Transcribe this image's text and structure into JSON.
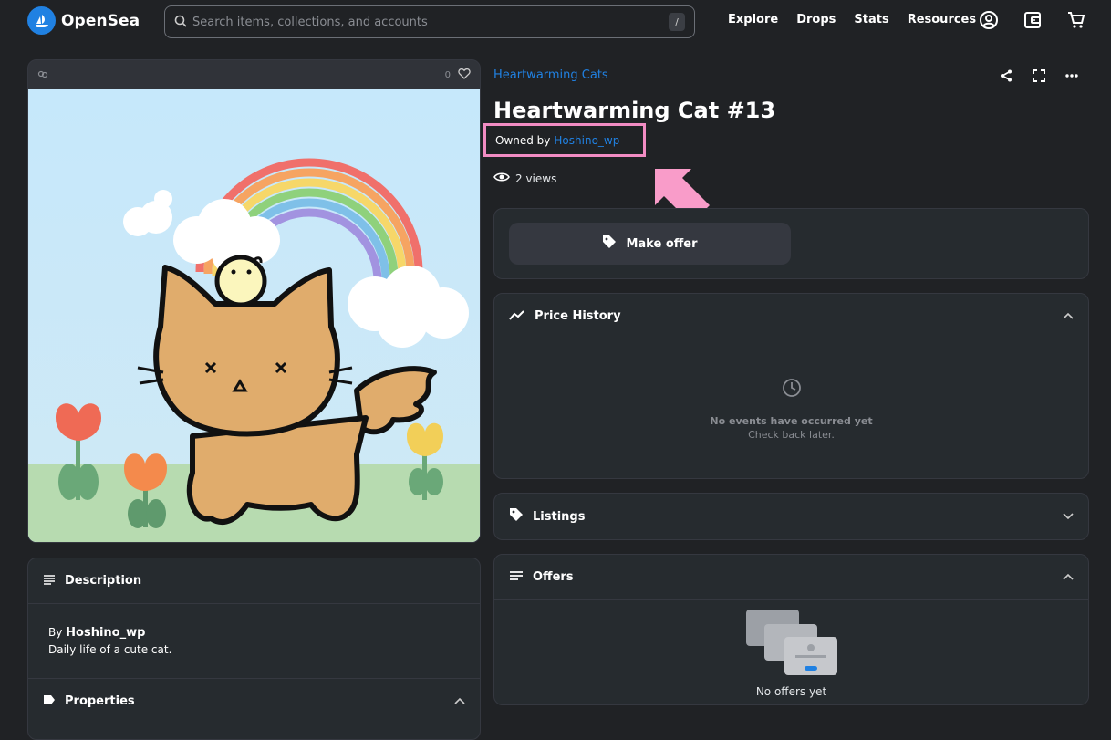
{
  "brand": {
    "name": "OpenSea",
    "color": "#2081e2"
  },
  "search": {
    "placeholder": "Search items, collections, and accounts",
    "shortcut": "/"
  },
  "nav": {
    "explore": "Explore",
    "drops": "Drops",
    "stats": "Stats",
    "resources": "Resources"
  },
  "media": {
    "favorites": "0"
  },
  "asset": {
    "collection": "Heartwarming Cats",
    "title": "Heartwarming Cat #13",
    "owned_by_label": "Owned by",
    "owner": "Hoshino_wp",
    "views": "2 views"
  },
  "offer": {
    "make_offer_label": "Make offer"
  },
  "price_history": {
    "title": "Price History",
    "empty_title": "No events have occurred yet",
    "empty_sub": "Check back later."
  },
  "listings": {
    "title": "Listings"
  },
  "offers": {
    "title": "Offers",
    "empty": "No offers yet"
  },
  "description": {
    "title": "Description",
    "by_label": "By",
    "creator": "Hoshino_wp",
    "text": "Daily life of a cute cat."
  },
  "properties": {
    "title": "Properties"
  },
  "colors": {
    "background": "#202225",
    "panel": "#262b2f",
    "accent": "#2081e2",
    "highlight": "#f28cc3"
  }
}
